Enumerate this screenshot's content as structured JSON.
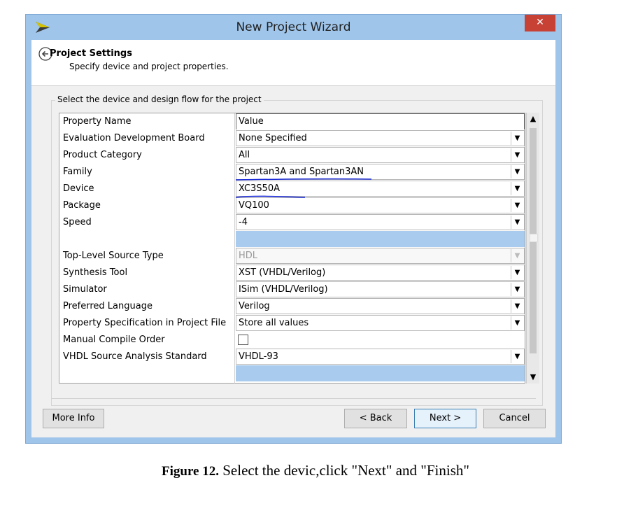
{
  "window": {
    "title": "New Project Wizard",
    "close_label": "✕"
  },
  "header": {
    "title": "Project Settings",
    "subtitle": "Specify device and project properties."
  },
  "group_label": "Select the device and design flow for the project",
  "table": {
    "col_name": "Property Name",
    "col_value": "Value",
    "rows": [
      {
        "name": "Evaluation Development Board",
        "value": "None Specified"
      },
      {
        "name": "Product Category",
        "value": "All"
      },
      {
        "name": "Family",
        "value": "Spartan3A and Spartan3AN"
      },
      {
        "name": "Device",
        "value": "XC3S50A"
      },
      {
        "name": "Package",
        "value": "VQ100"
      },
      {
        "name": "Speed",
        "value": "-4"
      },
      {
        "name": "Top-Level Source Type",
        "value": "HDL"
      },
      {
        "name": "Synthesis Tool",
        "value": "XST (VHDL/Verilog)"
      },
      {
        "name": "Simulator",
        "value": "ISim (VHDL/Verilog)"
      },
      {
        "name": "Preferred Language",
        "value": "Verilog"
      },
      {
        "name": "Property Specification in Project File",
        "value": "Store all values"
      },
      {
        "name": "Manual Compile Order",
        "value": ""
      },
      {
        "name": "VHDL Source Analysis Standard",
        "value": "VHDL-93"
      }
    ]
  },
  "buttons": {
    "more_info": "More Info",
    "back": "< Back",
    "next": "Next >",
    "cancel": "Cancel"
  },
  "caption": {
    "label": "Figure 12.",
    "text": " Select the devic,click \"Next\" and \"Finish\""
  },
  "colors": {
    "titlebar": "#9fc5ea",
    "close": "#c74135",
    "selection": "#a9cbee",
    "annotation_ink": "#1a2bd8"
  }
}
